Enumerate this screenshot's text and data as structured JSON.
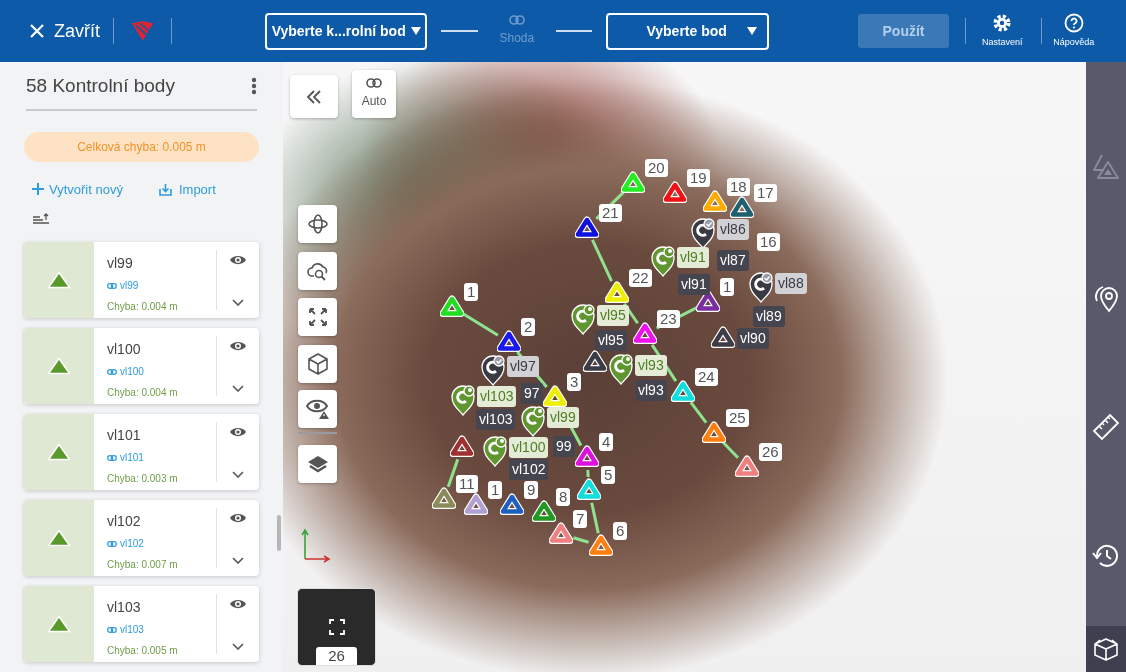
{
  "top_bar": {
    "close": "Zavřít",
    "checkpoint_select": {
      "value": "Vyberte k...rolní bod"
    },
    "match": {
      "label": "Shoda",
      "disabled": true
    },
    "point_select": {
      "value": "Vyberte bod"
    },
    "apply": {
      "label": "Použít",
      "disabled": true
    },
    "settings": "Nastavení",
    "help": "Nápověda"
  },
  "panel": {
    "title": "58 Kontrolní body",
    "total_error": "Celková chyba: 0.005 m",
    "create": "Vytvořit nový",
    "import": "Import",
    "points": [
      {
        "name": "vl99",
        "link": "vl99",
        "error": "Chyba: 0.004 m",
        "visible": true
      },
      {
        "name": "vl100",
        "link": "vl100",
        "error": "Chyba: 0.004 m",
        "visible": true
      },
      {
        "name": "vl101",
        "link": "vl101",
        "error": "Chyba: 0.003 m",
        "visible": true
      },
      {
        "name": "vl102",
        "link": "vl102",
        "error": "Chyba: 0.007 m",
        "visible": true
      },
      {
        "name": "vl103",
        "link": "vl103",
        "error": "Chyba: 0.005 m",
        "visible": true
      }
    ]
  },
  "map": {
    "auto": "Auto",
    "minimap_label": "26",
    "control_points": [
      {
        "label": "1",
        "color": "#22dd22"
      },
      {
        "label": "2",
        "color": "#1a1aee"
      },
      {
        "label": "3",
        "color": "#eeee00"
      },
      {
        "label": "4",
        "color": "#dd11dd"
      },
      {
        "label": "5",
        "color": "#11dddd"
      },
      {
        "label": "6",
        "color": "#ff7f0e"
      },
      {
        "label": "7",
        "color": "#f08080"
      },
      {
        "label": "11",
        "color": "#8b8b5a"
      },
      {
        "label": "1",
        "color": "#b0a0d0"
      },
      {
        "label": "9",
        "color": "#1f5fbf"
      },
      {
        "label": "8",
        "color": "#229922"
      },
      {
        "color": "#a03030"
      },
      {
        "label": "1",
        "color": "#7a2ea0"
      },
      {
        "label": "17",
        "color": "#1f5f6f"
      },
      {
        "label": "16"
      },
      {
        "label": "18",
        "color": "#ffaa00"
      },
      {
        "label": "19",
        "color": "#ee1111"
      },
      {
        "label": "20",
        "color": "#22ee22"
      },
      {
        "label": "21",
        "color": "#1111dd"
      },
      {
        "label": "22",
        "color": "#eeee00"
      },
      {
        "label": "23",
        "color": "#ee11ee"
      },
      {
        "label": "24",
        "color": "#11dddd"
      },
      {
        "label": "25",
        "color": "#ff7f0e"
      },
      {
        "label": "26",
        "color": "#f08080"
      }
    ],
    "pins": [
      {
        "label": "vl86",
        "verified": true
      },
      {
        "label": "vl91",
        "verified": false
      },
      {
        "label": "vl88",
        "verified": true
      },
      {
        "label": "vl95",
        "verified": false
      },
      {
        "label": "vl93",
        "verified": false
      },
      {
        "label": "vl97",
        "verified": true
      },
      {
        "label": "vl103",
        "verified": false
      },
      {
        "label": "vl99",
        "verified": false
      },
      {
        "label": "vl100",
        "verified": false
      }
    ],
    "tags": [
      "vl87",
      "vl91",
      "vl89",
      "vl90",
      "vl95",
      "vl93",
      "97",
      "vl103",
      "99",
      "vl102"
    ]
  }
}
